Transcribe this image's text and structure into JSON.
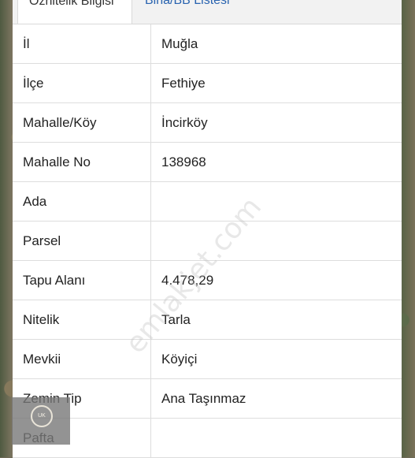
{
  "tabs": [
    {
      "label": "Öznitelik Bilgisi",
      "active": true
    },
    {
      "label": "Bina/BB Listesi",
      "active": false
    }
  ],
  "rows": [
    {
      "key": "İl",
      "value": "Muğla"
    },
    {
      "key": "İlçe",
      "value": "Fethiye"
    },
    {
      "key": "Mahalle/Köy",
      "value": "İncirköy"
    },
    {
      "key": "Mahalle No",
      "value": "138968"
    },
    {
      "key": "Ada",
      "value": ""
    },
    {
      "key": "Parsel",
      "value": ""
    },
    {
      "key": "Tapu Alanı",
      "value": "4.478,29"
    },
    {
      "key": "Nitelik",
      "value": "Tarla"
    },
    {
      "key": "Mevkii",
      "value": "Köyiçi"
    },
    {
      "key": "Zemin Tip",
      "value": "Ana Taşınmaz"
    },
    {
      "key": "Pafta",
      "value": ""
    }
  ],
  "watermark": "emlakjet.com",
  "logo_text": "UK",
  "colors": {
    "tab_link": "#2a64b0",
    "text": "#222222",
    "border": "#dddddd"
  }
}
